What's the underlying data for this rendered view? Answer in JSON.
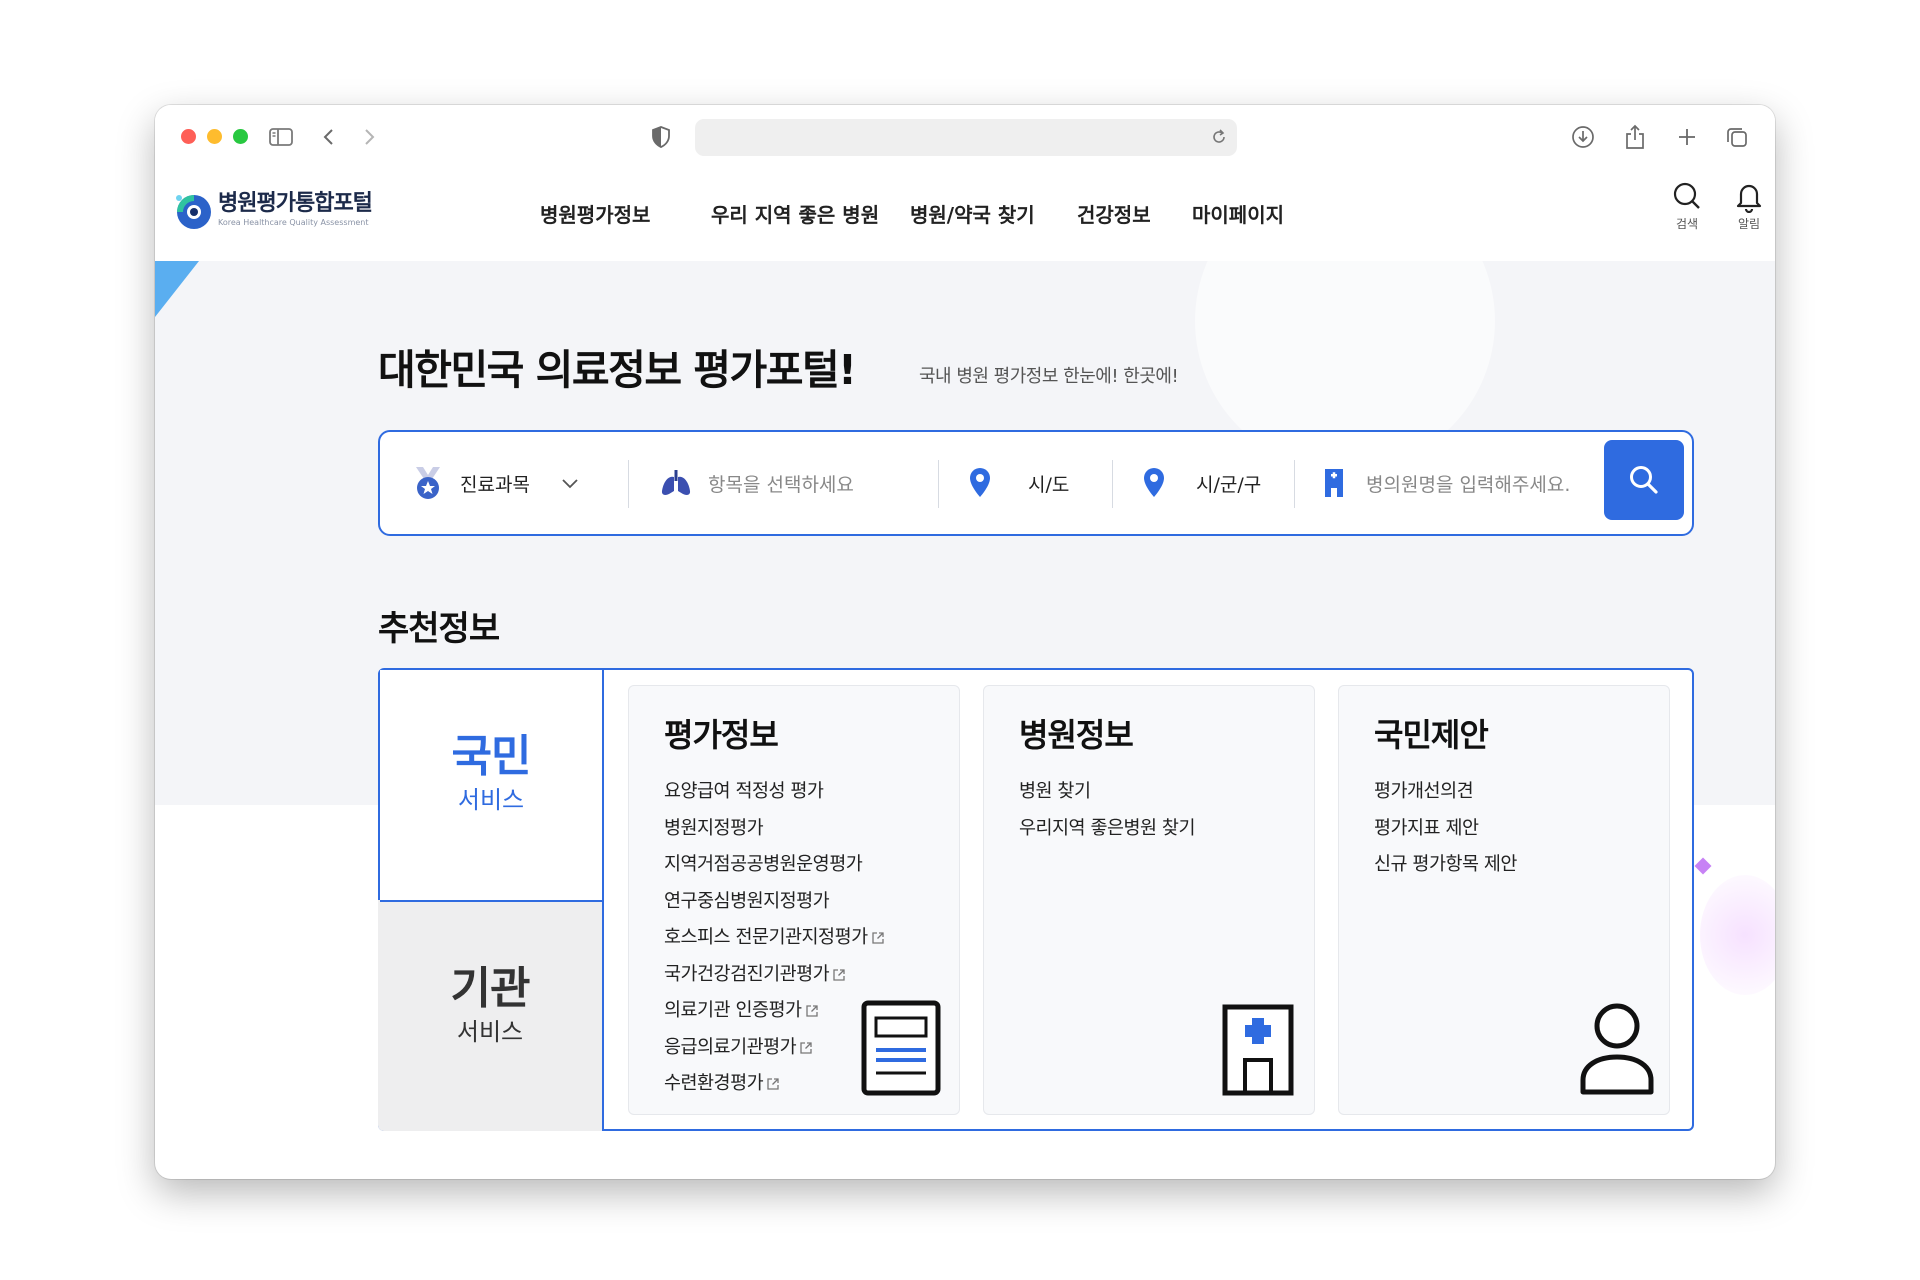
{
  "site": {
    "logo_title": "병원평가통합포털",
    "logo_sub": "Korea Healthcare Quality Assessment"
  },
  "nav": {
    "items": [
      {
        "label": "병원평가정보"
      },
      {
        "label": "우리 지역 좋은 병원"
      },
      {
        "label": "병원/약국 찾기"
      },
      {
        "label": "건강정보"
      },
      {
        "label": "마이페이지"
      }
    ],
    "search_label": "검색",
    "alert_label": "알림"
  },
  "hero": {
    "title": "대한민국 의료정보 평가포털!",
    "subtitle": "국내 병원 평가정보 한눈에! 한곳에!"
  },
  "search": {
    "department_label": "진료과목",
    "item_placeholder": "항목을 선택하세요",
    "sido_label": "시/도",
    "sigungu_label": "시/군/구",
    "hospital_placeholder": "병의원명을 입력해주세요."
  },
  "recommend": {
    "title": "추천정보",
    "tabs": {
      "citizen_main": "국민",
      "citizen_sub": "서비스",
      "org_main": "기관",
      "org_sub": "서비스"
    },
    "cards": [
      {
        "title": "평가정보",
        "items": [
          "요양급여 적정성 평가",
          "병원지정평가",
          "지역거점공공병원운영평가",
          "연구중심병원지정평가",
          "호스피스 전문기관지정평가",
          "국가건강검진기관평가",
          "의료기관 인증평가",
          "응급의료기관평가",
          "수련환경평가"
        ]
      },
      {
        "title": "병원정보",
        "items": [
          "병원 찾기",
          "우리지역 좋은병원 찾기"
        ]
      },
      {
        "title": "국민제안",
        "items": [
          "평가개선의견",
          "평가지표 제안",
          "신규 평가항목 제안"
        ]
      }
    ]
  },
  "colors": {
    "accent": "#2f6be0",
    "hero_bg": "#f4f5f8"
  }
}
